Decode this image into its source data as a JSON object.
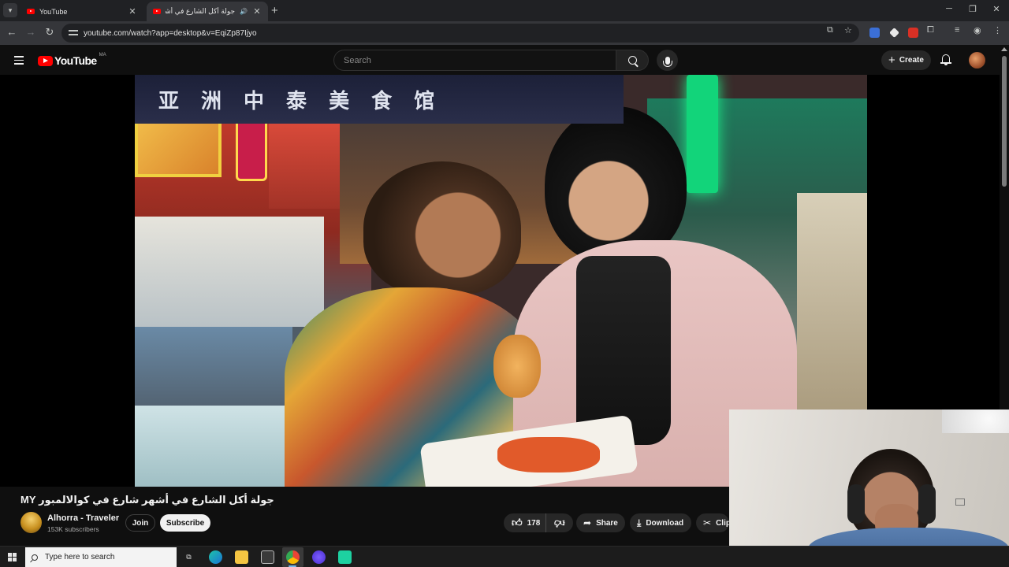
{
  "browser": {
    "tabs": [
      {
        "title": "YouTube",
        "active": false
      },
      {
        "title": "جولة أكل الشارع في أشهر شا",
        "active": true,
        "audio": true
      }
    ],
    "url": "youtube.com/watch?app=desktop&v=EqiZp87Ijyo"
  },
  "header": {
    "logo_text": "YouTube",
    "region": "MA",
    "search_placeholder": "Search",
    "create_label": "Create"
  },
  "video": {
    "sign_chars": [
      "亚",
      "洲",
      "中",
      "泰",
      "美",
      "食",
      "馆"
    ],
    "title": "جولة أكل الشارع في أشهر شارع في كوالالمبور MY"
  },
  "channel": {
    "name": "Alhorra - Traveler",
    "subscribers": "153K subscribers",
    "join_label": "Join",
    "subscribe_label": "Subscribe"
  },
  "actions": {
    "likes": "178",
    "share_label": "Share",
    "download_label": "Download",
    "clip_label": "Clip"
  },
  "taskbar": {
    "search_placeholder": "Type here to search"
  },
  "colors": {
    "yt_red": "#ff0000",
    "background": "#0f0f0f",
    "chrome_dark": "#202124",
    "chrome_toolbar": "#35363a"
  }
}
